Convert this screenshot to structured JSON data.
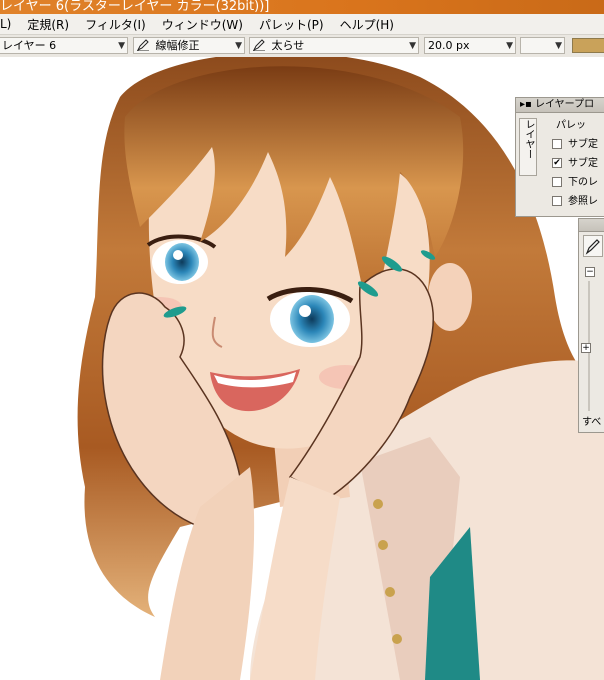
{
  "window": {
    "title": "レイヤー 6(ラスターレイヤー カラー(32bit))]"
  },
  "menu": [
    {
      "label": "L)"
    },
    {
      "label": "定規(R)"
    },
    {
      "label": "フィルタ(I)"
    },
    {
      "label": "ウィンドウ(W)"
    },
    {
      "label": "パレット(P)"
    },
    {
      "label": "ヘルプ(H)"
    }
  ],
  "toolbar": {
    "layer_select": "レイヤー 6",
    "line_correction": "線幅修正",
    "thicken": "太らせ",
    "size": "20.0 px",
    "color_swatch": "#c9a25a"
  },
  "layer_property": {
    "header": "レイヤープロ",
    "side_tab": "レイヤー",
    "palette_tab": "パレッ",
    "options": [
      {
        "label": "サブ定",
        "checked": false
      },
      {
        "label": "サブ定",
        "checked": true
      },
      {
        "label": "下のレ",
        "checked": false
      },
      {
        "label": "参照レ",
        "checked": false
      }
    ],
    "checkmark": "✔"
  },
  "side_panel": {
    "minus": "−",
    "plus": "+",
    "bottom_label": "すべ"
  },
  "colors": {
    "hair": "#b4652a",
    "skin": "#f7dcc6",
    "eyes": "#2b86b8",
    "nails": "#1f9c8e"
  }
}
